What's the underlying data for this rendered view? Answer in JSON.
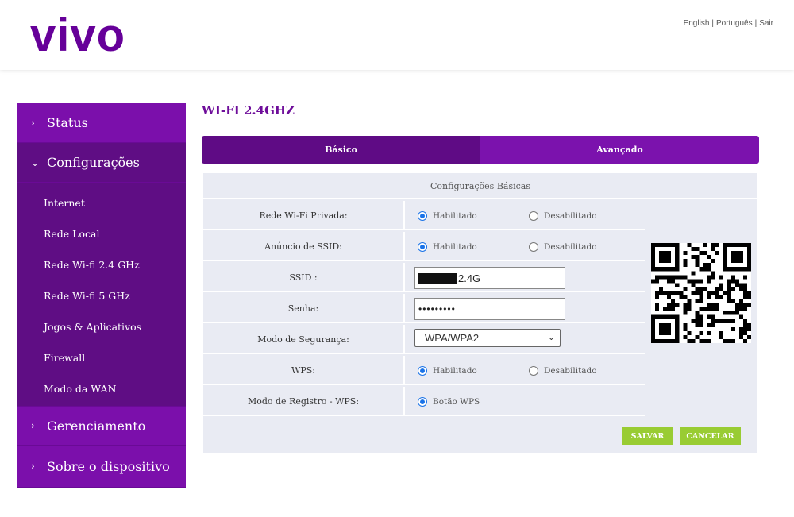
{
  "brand": {
    "logo_text": "vivo",
    "primary_color": "#660099",
    "accent_color": "#99cc33"
  },
  "header": {
    "links": [
      {
        "label": "English"
      },
      {
        "label": "Português"
      },
      {
        "label": "Sair"
      }
    ],
    "separator": "|"
  },
  "sidebar": {
    "status": {
      "label": "Status",
      "icon": "chevron-right-icon"
    },
    "config": {
      "label": "Configurações",
      "icon": "chevron-down-icon"
    },
    "config_items": [
      {
        "label": "Internet"
      },
      {
        "label": "Rede Local"
      },
      {
        "label": "Rede Wi-fi 2.4 GHz"
      },
      {
        "label": "Rede Wi-fi 5 GHz"
      },
      {
        "label": "Jogos & Aplicativos"
      },
      {
        "label": "Firewall"
      },
      {
        "label": "Modo da WAN"
      }
    ],
    "management": {
      "label": "Gerenciamento",
      "icon": "chevron-right-icon"
    },
    "about": {
      "label": "Sobre o dispositivo",
      "icon": "chevron-right-icon"
    }
  },
  "main": {
    "title": "WI-FI 2.4GHZ",
    "tabs": [
      {
        "label": "Básico",
        "active": true
      },
      {
        "label": "Avançado",
        "active": false
      }
    ],
    "panel_title": "Configurações Básicas",
    "rows": {
      "private_network": {
        "label": "Rede Wi-Fi Privada:",
        "enabled": "Habilitado",
        "disabled": "Desabilitado"
      },
      "ssid_broadcast": {
        "label": "Anúncio de SSID:",
        "enabled": "Habilitado",
        "disabled": "Desabilitado"
      },
      "ssid": {
        "label": "SSID :",
        "value_suffix": "2.4G"
      },
      "password": {
        "label": "Senha:",
        "value": "•••••••••"
      },
      "security_mode": {
        "label": "Modo de Segurança:",
        "selected": "WPA/WPA2"
      },
      "wps": {
        "label": "WPS:",
        "enabled": "Habilitado",
        "disabled": "Desabilitado"
      },
      "wps_mode": {
        "label": "Modo de Registro - WPS:",
        "option": "Botão WPS"
      }
    },
    "buttons": {
      "save": "SALVAR",
      "cancel": "CANCELAR"
    }
  }
}
